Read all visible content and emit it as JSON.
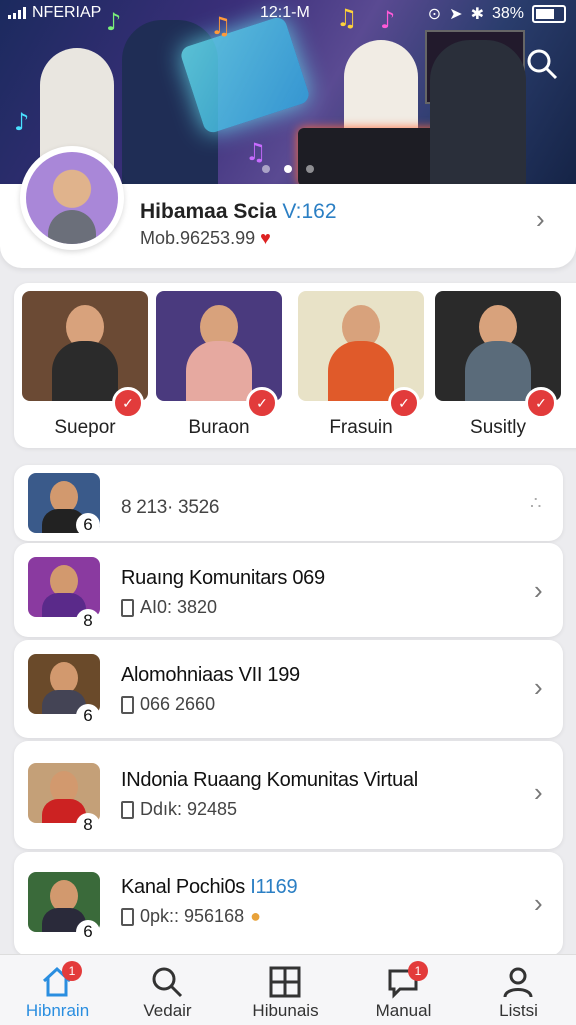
{
  "status_bar": {
    "carrier": "NFERIAP",
    "time": "12:1-M",
    "battery": "38%"
  },
  "hero": {
    "slide_count": 3,
    "active_slide": 2,
    "search_icon": "search-icon"
  },
  "profile": {
    "name": "Hibamaa Scia",
    "tag": "V:162",
    "subtitle": "Mob.96253.99"
  },
  "featured": [
    {
      "label": "Suepor",
      "bg": "#6b4a34",
      "shirt": "#2b2b2b"
    },
    {
      "label": "Buraon",
      "bg": "#4a3a7e",
      "shirt": "#e6a9a0"
    },
    {
      "label": "Frasuin",
      "bg": "#e8e2c7",
      "shirt": "#e05a2a"
    },
    {
      "label": "Susitly",
      "bg": "#2a2a2a",
      "shirt": "#5a6b7a"
    }
  ],
  "rooms": [
    {
      "title": "8  213· 3526",
      "tag": "",
      "meta": "",
      "count": "6",
      "bg": "#3a5a8a",
      "shirt": "#222"
    },
    {
      "title": "Ruaıng Komunitars 069",
      "tag": "",
      "meta": "AI0: 3820",
      "count": "8",
      "bg": "#8a3aa0",
      "shirt": "#5a2a8a"
    },
    {
      "title": "Alomohniaas VII 199",
      "tag": "",
      "meta": "066 2660",
      "count": "6",
      "bg": "#6a4a2a",
      "shirt": "#445"
    },
    {
      "title": "INdonia Ruaang Komunitas Virtual",
      "tag": "",
      "meta": "Ddık: 92485",
      "count": "8",
      "bg": "#c4a078",
      "shirt": "#c22"
    },
    {
      "title": "Kanal Pochi0s ",
      "tag": "I1169",
      "meta": "0pk:: 956168",
      "count": "6",
      "bg": "#3a6a3a",
      "shirt": "#2a2a3a"
    }
  ],
  "tabs": [
    {
      "label": "Hibnrain",
      "icon": "home-icon",
      "badge": "1",
      "active": true
    },
    {
      "label": "Vedair",
      "icon": "search-icon",
      "badge": "",
      "active": false
    },
    {
      "label": "Hibunais",
      "icon": "grid-icon",
      "badge": "",
      "active": false
    },
    {
      "label": "Manual",
      "icon": "chat-icon",
      "badge": "1",
      "active": false
    },
    {
      "label": "Listsi",
      "icon": "person-icon",
      "badge": "",
      "active": false
    }
  ]
}
